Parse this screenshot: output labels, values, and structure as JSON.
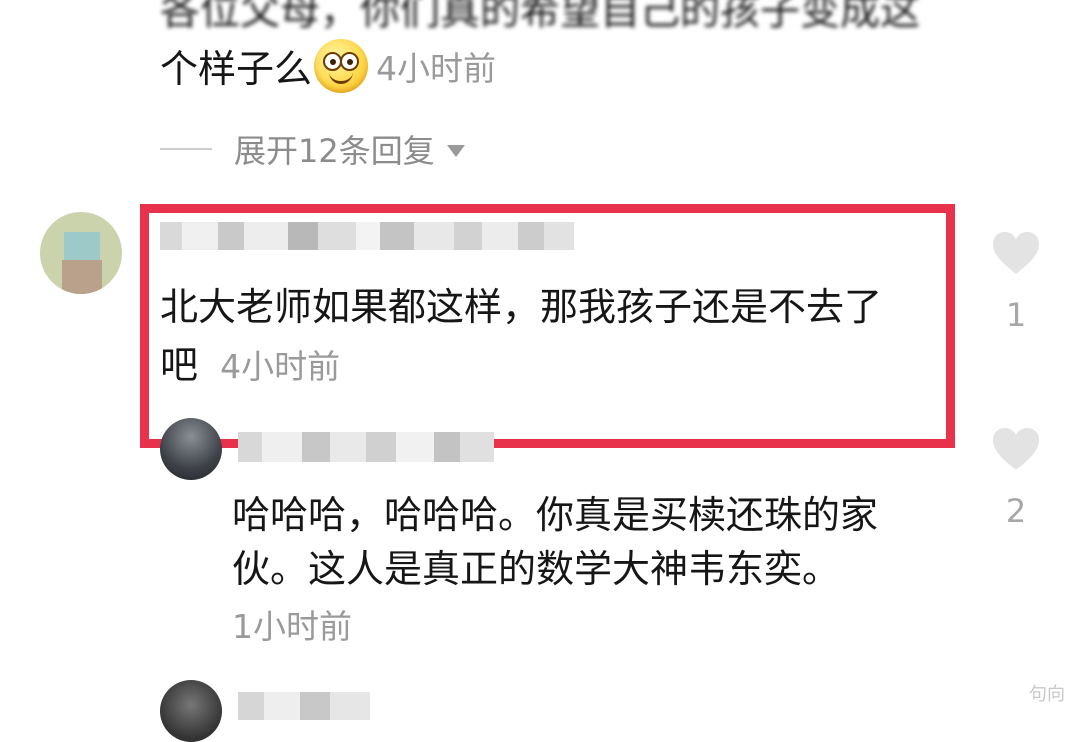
{
  "previous_comment": {
    "clipped_line": "各位父母，你们真的希望自己的孩子变成这",
    "line": "个样子么",
    "emoji": "grinning-face-emoji",
    "time": "4小时前",
    "expand_replies": "展开12条回复"
  },
  "main_comment": {
    "text_line1": "北大老师如果都这样，那我孩子还是不去了",
    "text_line2": "吧",
    "time": "4小时前",
    "likes": "1",
    "highlight_color": "#e8314a"
  },
  "reply": {
    "text_line1": "哈哈哈，哈哈哈。你真是买椟还珠的家",
    "text_line2": "伙。这人是真正的数学大神韦东奕。",
    "time": "1小时前",
    "likes": "2"
  },
  "colors": {
    "text": "#161616",
    "secondary": "#9a9a9a",
    "heart": "#e3e3e3"
  },
  "watermark": "句向"
}
